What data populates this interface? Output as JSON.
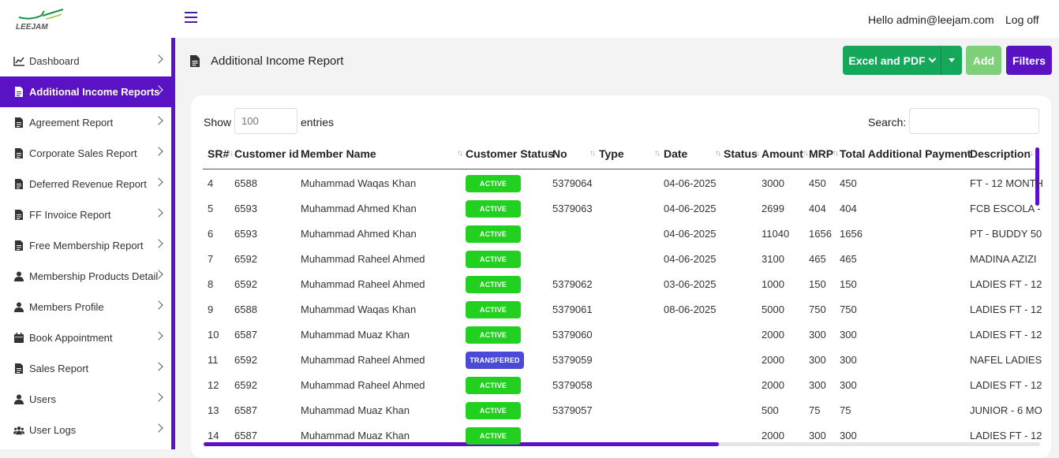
{
  "header": {
    "logo_text": "LEEJAM",
    "greeting": "Hello admin@leejam.com",
    "logoff": "Log off"
  },
  "sidebar": {
    "items": [
      {
        "label": "Dashboard",
        "icon": "chart-line-icon",
        "active": false
      },
      {
        "label": "Additional Income Reports",
        "icon": "file-icon",
        "active": true
      },
      {
        "label": "Agreement Report",
        "icon": "file-icon",
        "active": false
      },
      {
        "label": "Corporate Sales Report",
        "icon": "file-icon",
        "active": false
      },
      {
        "label": "Deferred Revenue Report",
        "icon": "file-icon",
        "active": false
      },
      {
        "label": "FF Invoice Report",
        "icon": "file-icon",
        "active": false
      },
      {
        "label": "Free Membership Report",
        "icon": "file-icon",
        "active": false
      },
      {
        "label": "Membership Products Detail",
        "icon": "user-icon",
        "active": false
      },
      {
        "label": "Members Profile",
        "icon": "user-icon",
        "active": false
      },
      {
        "label": "Book Appointment",
        "icon": "calendar-icon",
        "active": false
      },
      {
        "label": "Sales Report",
        "icon": "file-icon",
        "active": false
      },
      {
        "label": "Users",
        "icon": "user-icon",
        "active": false
      },
      {
        "label": "User Logs",
        "icon": "users-icon",
        "active": false
      }
    ]
  },
  "page": {
    "title": "Additional Income Report",
    "export_label": "Excel and PDF",
    "add_label": "Add",
    "filters_label": "Filters"
  },
  "table_controls": {
    "show_label": "Show",
    "show_placeholder": "100",
    "entries_label": "entries",
    "search_label": "Search:"
  },
  "table": {
    "columns": [
      "SR#",
      "Customer id",
      "Member Name",
      "Customer Status",
      "No",
      "Type",
      "Date",
      "Status",
      "Amount",
      "MRP",
      "Total Additional Payment",
      "Description"
    ],
    "rows": [
      {
        "sr": "4",
        "cid": "6588",
        "name": "Muhammad Waqas Khan",
        "status": "ACTIVE",
        "no": "5379064",
        "type": "",
        "date": "04-06-2025",
        "st": "",
        "amount": "3000",
        "mrp": "450",
        "total": "450",
        "desc": "FT - 12 MONTH"
      },
      {
        "sr": "5",
        "cid": "6593",
        "name": "Muhammad Ahmed Khan",
        "status": "ACTIVE",
        "no": "5379063",
        "type": "",
        "date": "04-06-2025",
        "st": "",
        "amount": "2699",
        "mrp": "404",
        "total": "404",
        "desc": "FCB ESCOLA -"
      },
      {
        "sr": "6",
        "cid": "6593",
        "name": "Muhammad Ahmed Khan",
        "status": "ACTIVE",
        "no": "",
        "type": "",
        "date": "04-06-2025",
        "st": "",
        "amount": "11040",
        "mrp": "1656",
        "total": "1656",
        "desc": "PT - BUDDY 50"
      },
      {
        "sr": "7",
        "cid": "6592",
        "name": "Muhammad Raheel Ahmed",
        "status": "ACTIVE",
        "no": "",
        "type": "",
        "date": "04-06-2025",
        "st": "",
        "amount": "3100",
        "mrp": "465",
        "total": "465",
        "desc": "MADINA AZIZI"
      },
      {
        "sr": "8",
        "cid": "6592",
        "name": "Muhammad Raheel Ahmed",
        "status": "ACTIVE",
        "no": "5379062",
        "type": "",
        "date": "03-06-2025",
        "st": "",
        "amount": "1000",
        "mrp": "150",
        "total": "150",
        "desc": "LADIES FT - 12"
      },
      {
        "sr": "9",
        "cid": "6588",
        "name": "Muhammad Waqas Khan",
        "status": "ACTIVE",
        "no": "5379061",
        "type": "",
        "date": "08-06-2025",
        "st": "",
        "amount": "5000",
        "mrp": "750",
        "total": "750",
        "desc": "LADIES FT - 12"
      },
      {
        "sr": "10",
        "cid": "6587",
        "name": "Muhammad Muaz Khan",
        "status": "ACTIVE",
        "no": "5379060",
        "type": "",
        "date": "",
        "st": "",
        "amount": "2000",
        "mrp": "300",
        "total": "300",
        "desc": "LADIES FT - 12"
      },
      {
        "sr": "11",
        "cid": "6592",
        "name": "Muhammad Raheel Ahmed",
        "status": "TRANSFERED",
        "no": "5379059",
        "type": "",
        "date": "",
        "st": "",
        "amount": "2000",
        "mrp": "300",
        "total": "300",
        "desc": "NAFEL LADIES"
      },
      {
        "sr": "12",
        "cid": "6592",
        "name": "Muhammad Raheel Ahmed",
        "status": "ACTIVE",
        "no": "5379058",
        "type": "",
        "date": "",
        "st": "",
        "amount": "2000",
        "mrp": "300",
        "total": "300",
        "desc": "LADIES FT - 12"
      },
      {
        "sr": "13",
        "cid": "6587",
        "name": "Muhammad Muaz Khan",
        "status": "ACTIVE",
        "no": "5379057",
        "type": "",
        "date": "",
        "st": "",
        "amount": "500",
        "mrp": "75",
        "total": "75",
        "desc": "JUNIOR - 6 MO"
      },
      {
        "sr": "14",
        "cid": "6587",
        "name": "Muhammad Muaz Khan",
        "status": "ACTIVE",
        "no": "",
        "type": "",
        "date": "",
        "st": "",
        "amount": "2000",
        "mrp": "300",
        "total": "300",
        "desc": "LADIES FT - 12"
      }
    ]
  },
  "colors": {
    "accent": "#5a13c4",
    "export_green": "#16a85a",
    "add_green": "#7ed07a",
    "active_badge": "#22d11f",
    "transfer_badge": "#4a4ad6"
  }
}
